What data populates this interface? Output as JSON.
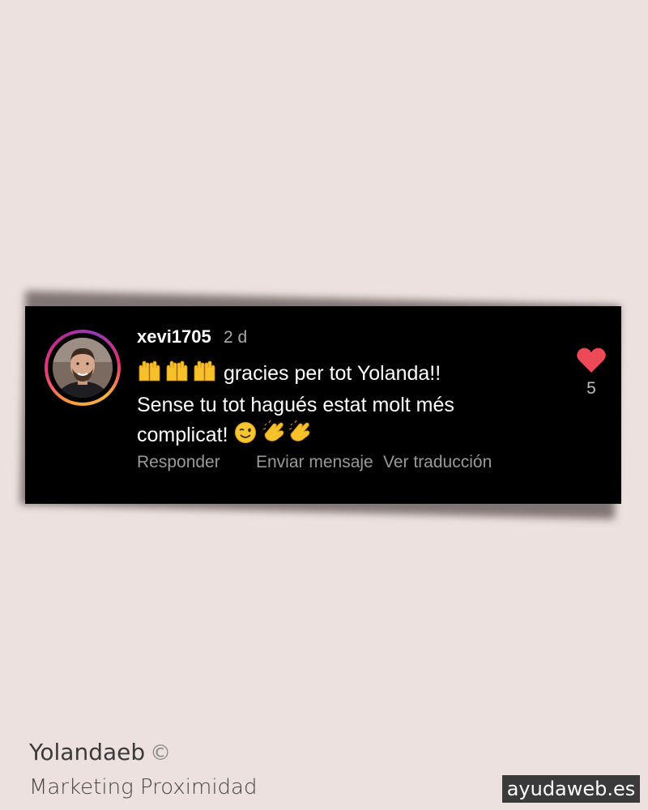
{
  "comment": {
    "username": "xevi1705",
    "timestamp": "2 d",
    "text_line1": "gracies per tot Yolanda!!",
    "text_line2": "Sense tu tot hagués estat molt més",
    "text_line3": "complicat!",
    "likes": "5",
    "actions": {
      "reply": "Responder",
      "send": "Enviar mensaje",
      "translate": "Ver traducción"
    },
    "liked": true
  },
  "icons": {
    "avatar": "profile-photo",
    "raised_hands": "raised-hands-emoji",
    "wink": "winking-face-emoji",
    "clap": "clapping-hands-emoji",
    "heart": "heart-icon"
  },
  "colors": {
    "background": "#ece1df",
    "card": "#000000",
    "heart": "#ed4956",
    "secondary_text": "#a8a8a8"
  },
  "footer": {
    "name": "Yolandaeb",
    "copyright": "©",
    "subtitle": "Marketing Proximidad",
    "watermark": "ayudaweb.es"
  }
}
